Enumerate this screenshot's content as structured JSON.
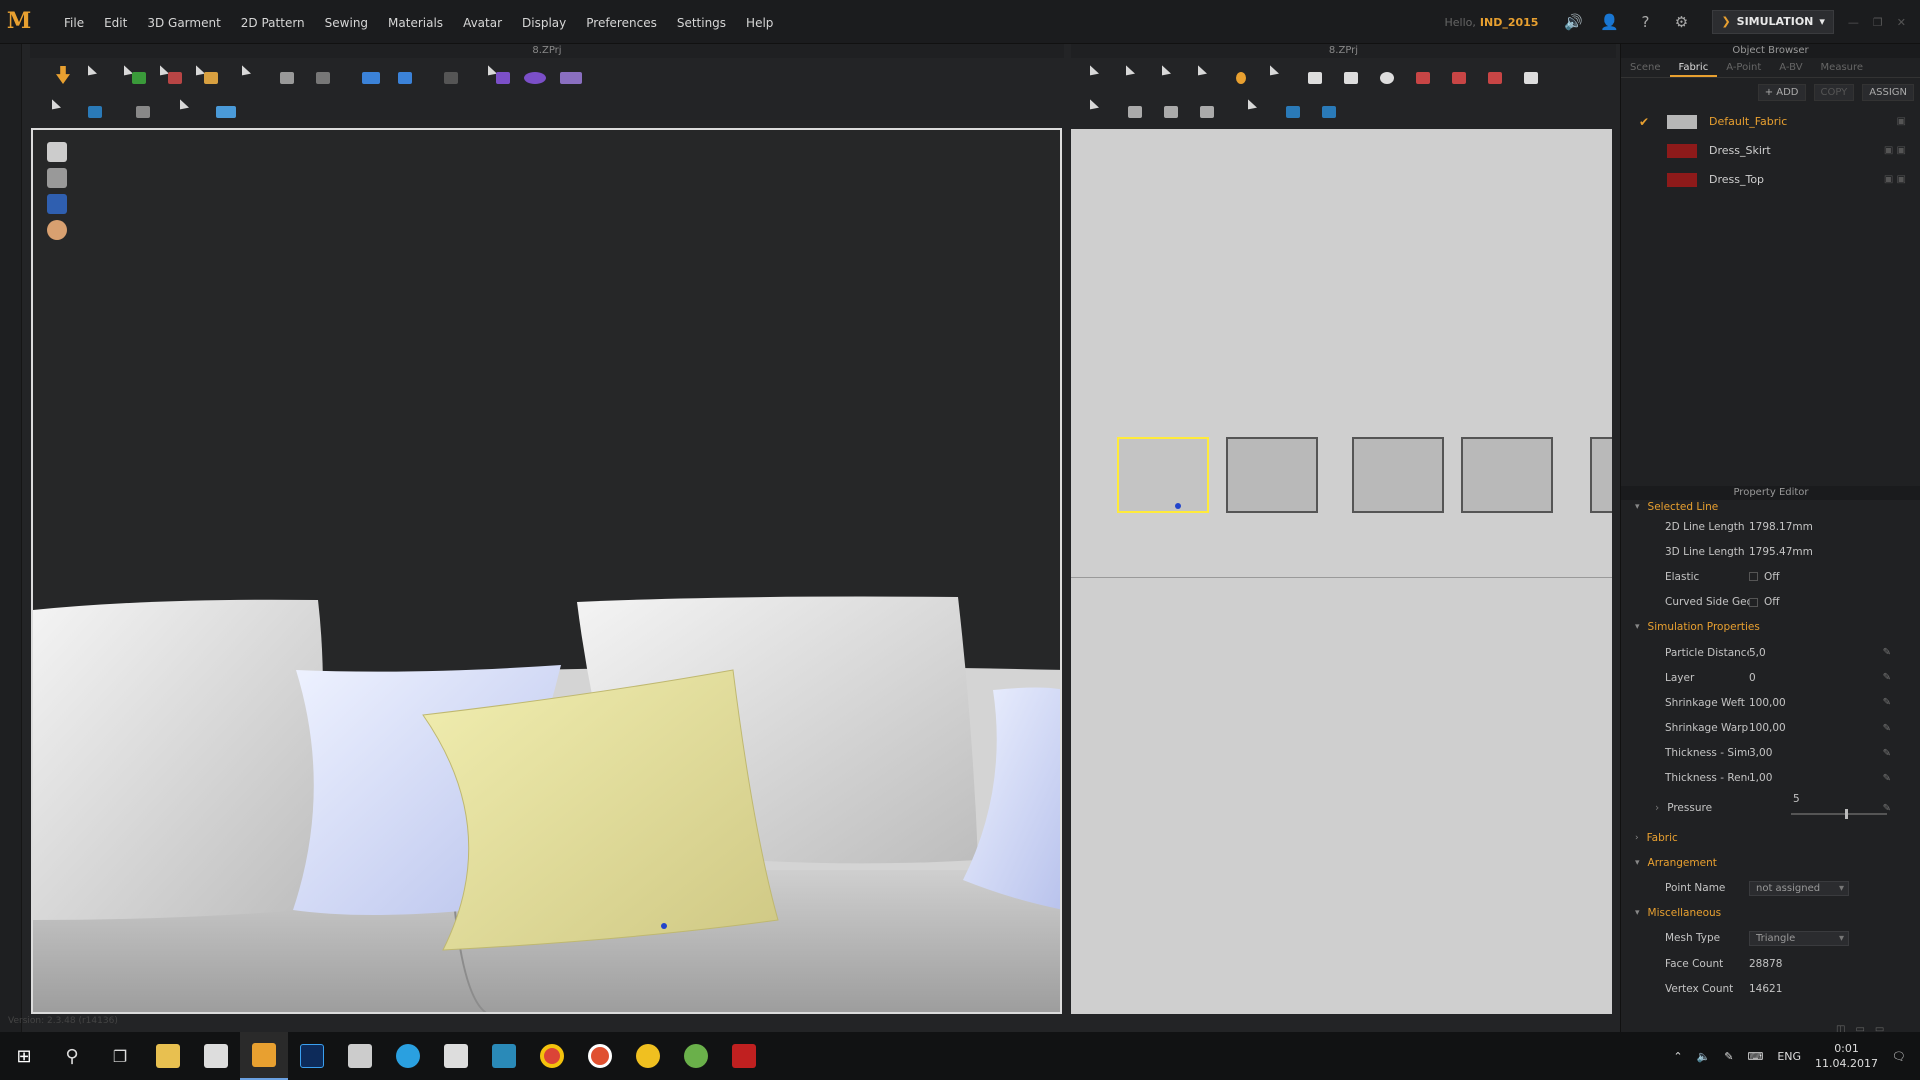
{
  "app": {
    "logo": "M",
    "menus": [
      "File",
      "Edit",
      "3D Garment",
      "2D Pattern",
      "Sewing",
      "Materials",
      "Avatar",
      "Display",
      "Preferences",
      "Settings",
      "Help"
    ],
    "hello": "Hello,",
    "user": "IND_2015",
    "mode": "SIMULATION"
  },
  "panels": {
    "left_title": "8.ZPrj",
    "right_title": "8.ZPrj"
  },
  "object_browser": {
    "title": "Object Browser",
    "tabs": [
      "Scene",
      "Fabric",
      "A-Point",
      "A-BV",
      "Measure"
    ],
    "active_tab": "Fabric",
    "actions": {
      "add": "+ ADD",
      "copy": "COPY",
      "assign": "ASSIGN"
    },
    "fabrics": [
      {
        "name": "Default_Fabric",
        "color": "#b7b7b7",
        "selected": true
      },
      {
        "name": "Dress_Skirt",
        "color": "#8e1a1a",
        "selected": false
      },
      {
        "name": "Dress_Top",
        "color": "#8e1a1a",
        "selected": false
      }
    ]
  },
  "property_editor": {
    "title": "Property Editor",
    "selected_line": "Selected Line",
    "line_2d_label": "2D Line Length",
    "line_2d": "1798.17mm",
    "line_3d_label": "3D Line Length",
    "line_3d": "1795.47mm",
    "elastic_label": "Elastic",
    "elastic": "Off",
    "curved_label": "Curved Side Geome",
    "curved": "Off",
    "sim_props": "Simulation Properties",
    "particle_label": "Particle Distance (m",
    "particle": "5,0",
    "layer_label": "Layer",
    "layer": "0",
    "weft_label": "Shrinkage Weft (%",
    "weft": "100,00",
    "warp_label": "Shrinkage Warp (%",
    "warp": "100,00",
    "thick_sim_label": "Thickness - Simulation",
    "thick_sim": "3,00",
    "thick_ren_label": "Thickness - Rendering",
    "thick_ren": "1,00",
    "pressure_label": "Pressure",
    "pressure": "5",
    "fabric": "Fabric",
    "arrangement": "Arrangement",
    "point_name_label": "Point Name",
    "point_name": "not assigned",
    "misc": "Miscellaneous",
    "mesh_type_label": "Mesh Type",
    "mesh_type": "Triangle",
    "face_count_label": "Face Count",
    "face_count": "28878",
    "vertex_count_label": "Vertex Count",
    "vertex_count": "14621"
  },
  "status": {
    "version": "Version: 2.3.48 (r14136)"
  },
  "taskbar": {
    "lang": "ENG",
    "time": "0:01",
    "date": "11.04.2017"
  }
}
